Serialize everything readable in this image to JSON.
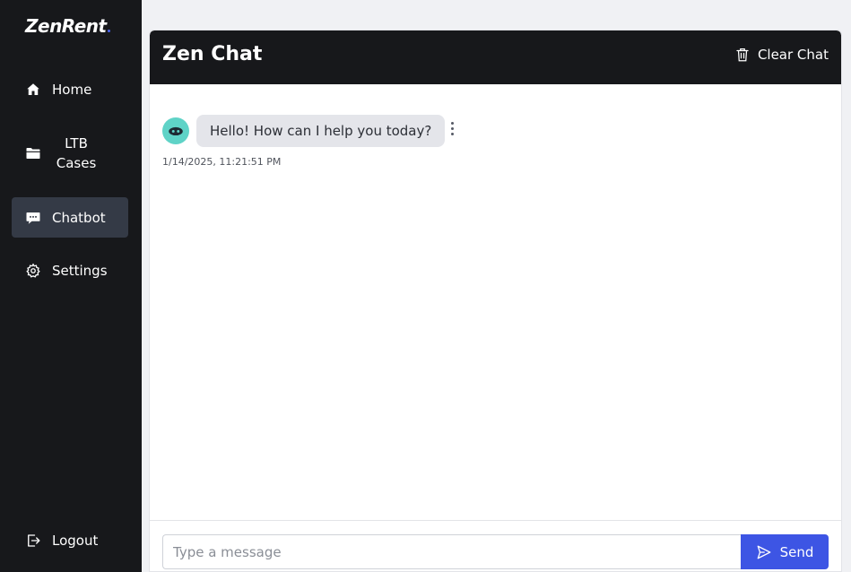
{
  "brand": {
    "name": "ZenRent"
  },
  "sidebar": {
    "items": [
      {
        "label": "Home",
        "icon": "home-icon"
      },
      {
        "label": "LTB Cases",
        "icon": "folder-icon"
      },
      {
        "label": "Chatbot",
        "icon": "chat-bubble-icon",
        "active": true
      },
      {
        "label": "Settings",
        "icon": "gear-icon"
      }
    ],
    "logout": {
      "label": "Logout",
      "icon": "logout-icon"
    }
  },
  "chat": {
    "title": "Zen Chat",
    "clear_label": "Clear Chat",
    "messages": [
      {
        "sender": "bot",
        "text": "Hello! How can I help you today?",
        "timestamp": "1/14/2025, 11:21:51 PM"
      }
    ],
    "input": {
      "placeholder": "Type a message",
      "value": ""
    },
    "send_label": "Send"
  },
  "colors": {
    "sidebar_bg": "#17181b",
    "active_item_bg": "#343a46",
    "accent": "#3d55e4",
    "avatar": "#5fd3c7",
    "bubble_bg": "#e4e5ea"
  }
}
